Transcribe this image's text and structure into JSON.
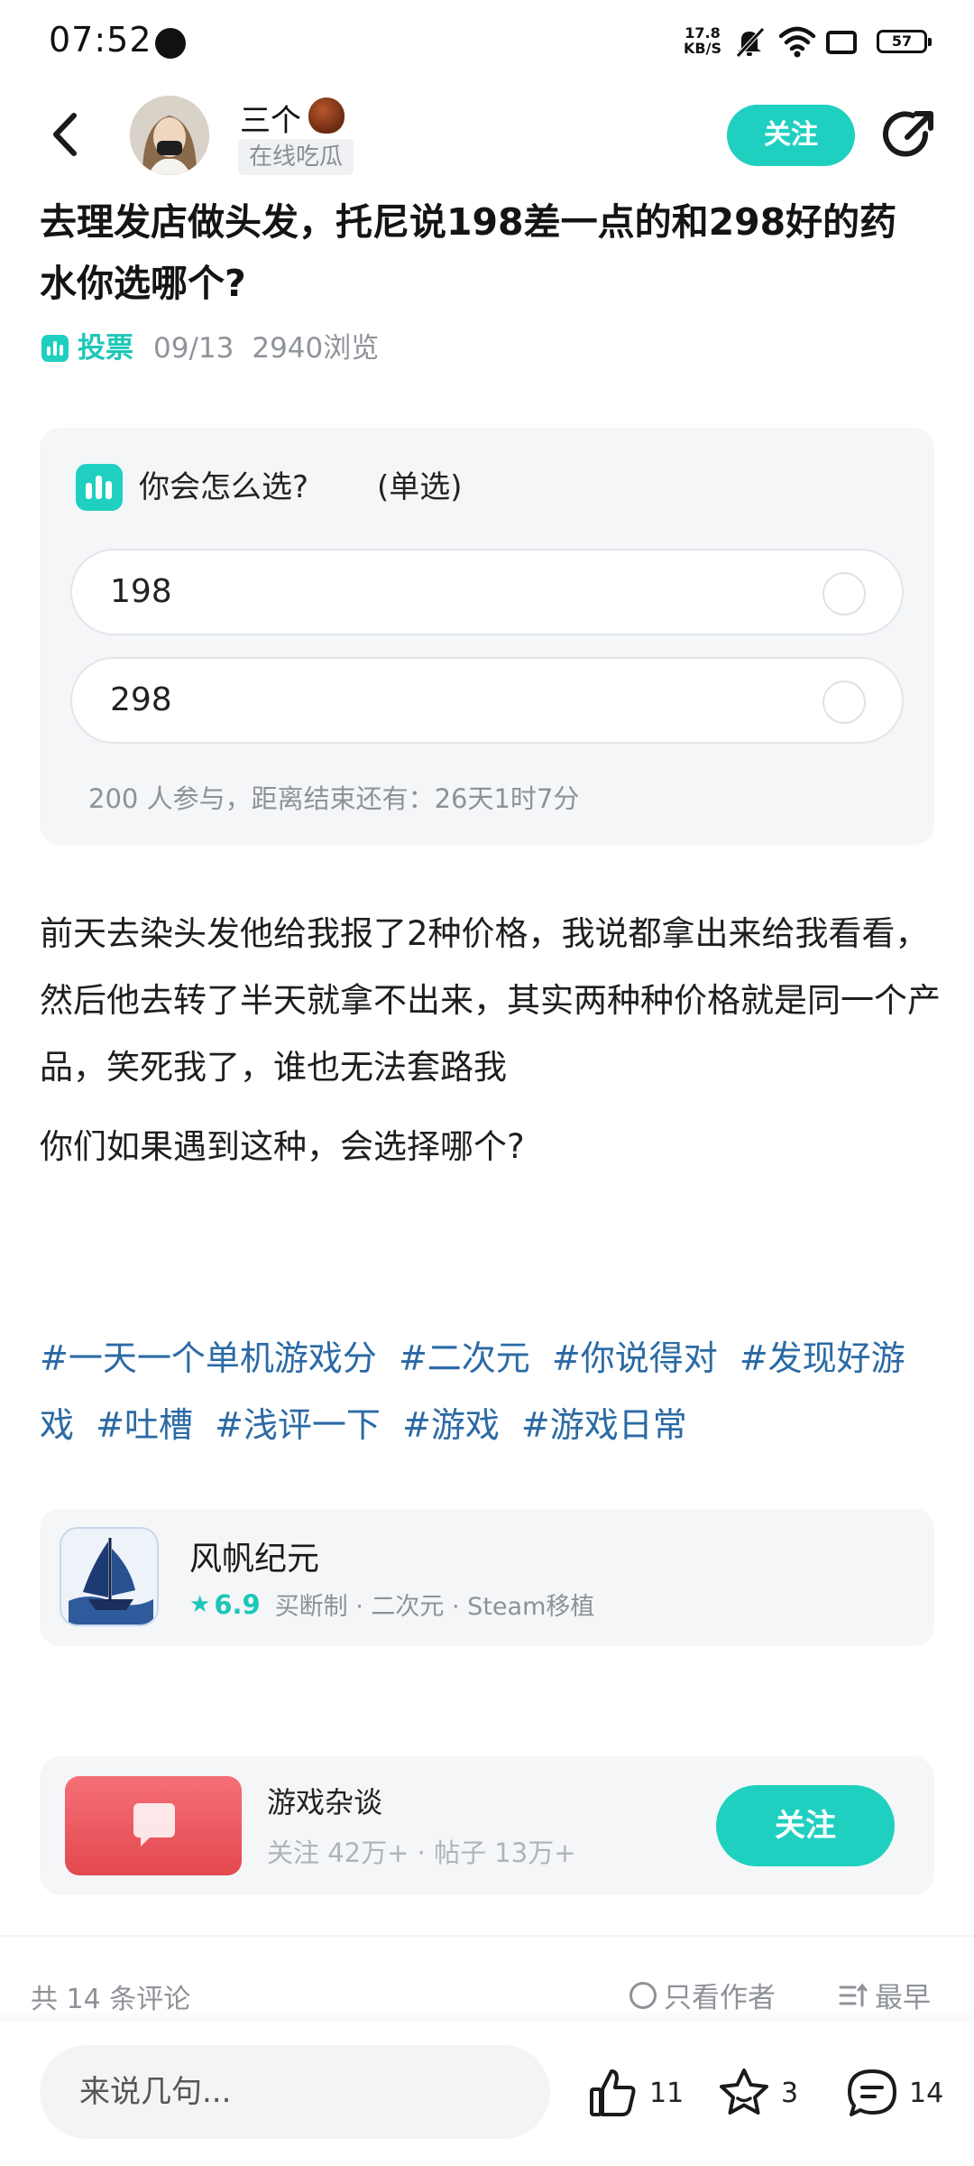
{
  "status_bar": {
    "time": "07:52",
    "net_speed_value": "17.8",
    "net_speed_unit": "KB/S",
    "battery": "57"
  },
  "header": {
    "author_name": "三个",
    "author_tag": "在线吃瓜",
    "follow_label": "关注"
  },
  "post": {
    "title": "去理发店做头发，托尼说198差一点的和298好的药水你选哪个?",
    "type": "投票",
    "date": "09/13",
    "views": "2940浏览",
    "body": [
      "前天去染头发他给我报了2种价格，我说都拿出来给我看看，然后他去转了半天就拿不出来，其实两种种价格就是同一个产品，笑死我了，谁也无法套路我",
      "你们如果遇到这种，会选择哪个?"
    ],
    "topics": [
      "#一天一个单机游戏分",
      "#二次元",
      "#你说得对",
      "#发现好游戏",
      "#吐槽",
      "#浅评一下",
      "#游戏",
      "#游戏日常"
    ]
  },
  "poll": {
    "question": "你会怎么选?",
    "mode": "(单选)",
    "options": [
      {
        "label": "198"
      },
      {
        "label": "298"
      }
    ],
    "footer": "200 人参与，距离结束还有：26天1时7分"
  },
  "game": {
    "name": "风帆纪元",
    "rating": "6.9",
    "tags": "买断制 · 二次元 · Steam移植"
  },
  "forum": {
    "name": "游戏杂谈",
    "stats": "关注 42万+ · 帖子 13万+",
    "follow_label": "关注"
  },
  "comments": {
    "count_label": "共 14 条评论",
    "author_only_label": "只看作者",
    "sort_label": "最早"
  },
  "bottom_bar": {
    "input_placeholder": "来说几句...",
    "likes": "11",
    "favorites": "3",
    "comments": "14"
  }
}
